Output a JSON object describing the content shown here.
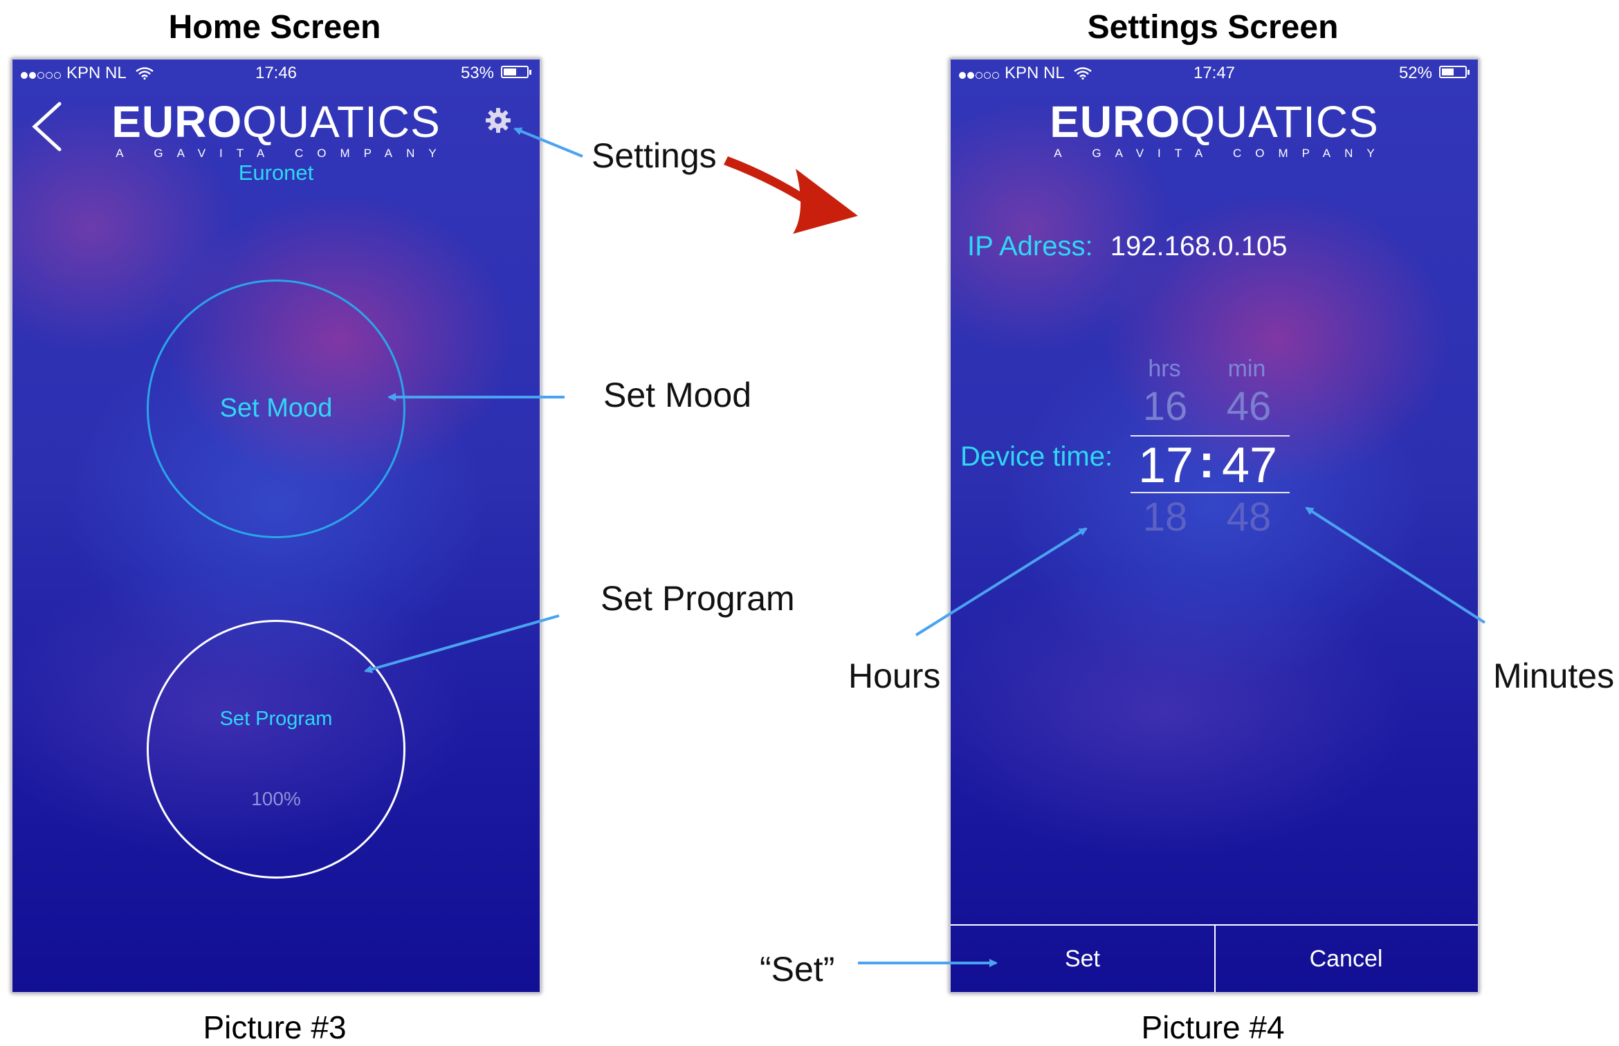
{
  "headings": {
    "home": "Home Screen",
    "settings": "Settings Screen"
  },
  "captions": {
    "left": "Picture #3",
    "right": "Picture #4"
  },
  "annotations": {
    "settings": "Settings",
    "set_mood": "Set Mood",
    "set_program": "Set Program",
    "hours": "Hours",
    "minutes": "Minutes",
    "set": "“Set”"
  },
  "colors": {
    "accent": "#2ed8f5",
    "arrow": "#4aa3f0",
    "red_arrow": "#c8200c",
    "bg_deep": "#120f94"
  },
  "home": {
    "status": {
      "carrier": "KPN NL",
      "time": "17:46",
      "battery": "53%",
      "battery_level": 0.53
    },
    "logo": {
      "bold": "EURO",
      "light": "QUATICS",
      "sub": "A GAVITA COMPANY"
    },
    "back_icon": "chevron-left-icon",
    "settings_icon": "gear-icon",
    "device_name": "Euronet",
    "set_mood_label": "Set Mood",
    "set_program_label": "Set Program",
    "program_percent": "100%"
  },
  "settings": {
    "status": {
      "carrier": "KPN NL",
      "time": "17:47",
      "battery": "52%",
      "battery_level": 0.52
    },
    "logo": {
      "bold": "EURO",
      "light": "QUATICS",
      "sub": "A GAVITA COMPANY"
    },
    "ip_label": "IP Adress:",
    "ip_value": "192.168.0.105",
    "device_time_label": "Device time:",
    "picker": {
      "hrs_label": "hrs",
      "min_label": "min",
      "hours_above": "16",
      "hours_selected": "17",
      "hours_below": "18",
      "minutes_above": "46",
      "minutes_selected": "47",
      "minutes_below": "48",
      "separator": ":"
    },
    "set_button": "Set",
    "cancel_button": "Cancel"
  }
}
